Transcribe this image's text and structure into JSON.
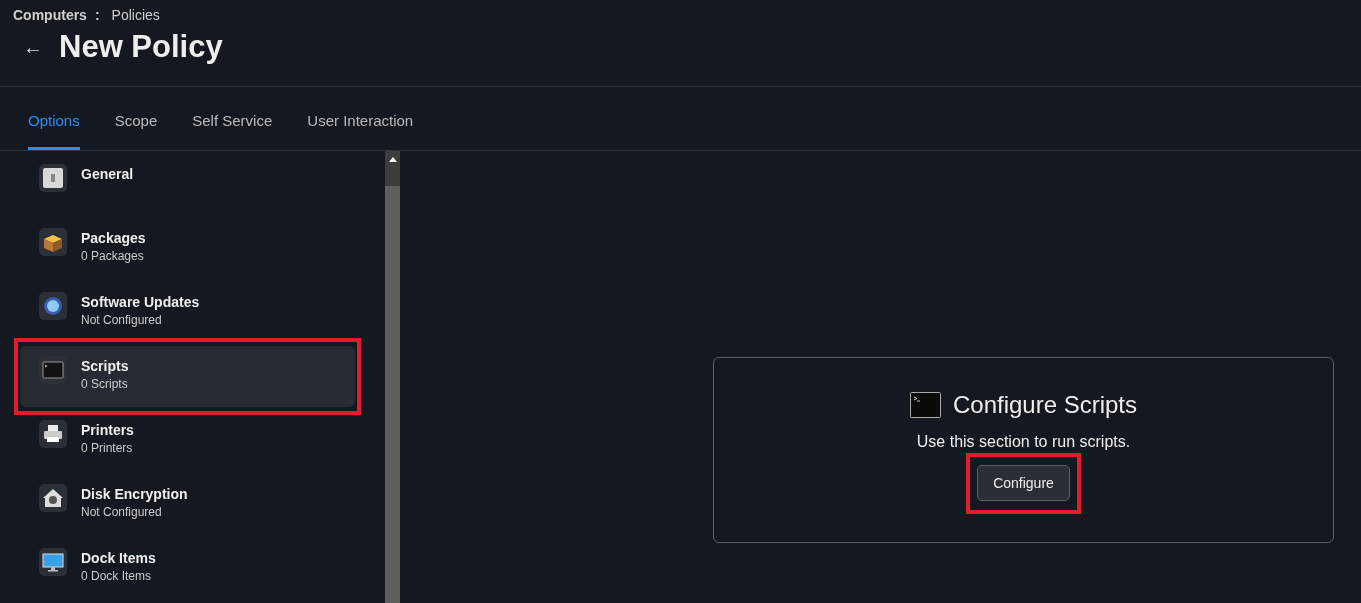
{
  "breadcrumb": {
    "parent": "Computers",
    "separator": ":",
    "current": "Policies"
  },
  "back_icon": "←",
  "title": "New Policy",
  "tabs": [
    {
      "label": "Options",
      "selected": true
    },
    {
      "label": "Scope",
      "selected": false
    },
    {
      "label": "Self Service",
      "selected": false
    },
    {
      "label": "User Interaction",
      "selected": false
    }
  ],
  "sidebar": {
    "items": [
      {
        "kind": "general",
        "title": "General",
        "selected": false,
        "highlighted": false
      },
      {
        "kind": "packages",
        "title": "Packages",
        "subtitle": "0 Packages",
        "selected": false,
        "highlighted": false
      },
      {
        "kind": "updates",
        "title": "Software Updates",
        "subtitle": "Not Configured",
        "selected": false,
        "highlighted": false
      },
      {
        "kind": "scripts",
        "title": "Scripts",
        "subtitle": "0 Scripts",
        "selected": true,
        "highlighted": true
      },
      {
        "kind": "printers",
        "title": "Printers",
        "subtitle": "0 Printers",
        "selected": false,
        "highlighted": false
      },
      {
        "kind": "encryption",
        "title": "Disk Encryption",
        "subtitle": "Not Configured",
        "selected": false,
        "highlighted": false
      },
      {
        "kind": "dock",
        "title": "Dock Items",
        "subtitle": "0 Dock Items",
        "selected": false,
        "highlighted": false
      }
    ]
  },
  "panel": {
    "title": "Configure Scripts",
    "description": "Use this section to run scripts.",
    "button": {
      "label": "Configure",
      "highlighted": true
    }
  }
}
